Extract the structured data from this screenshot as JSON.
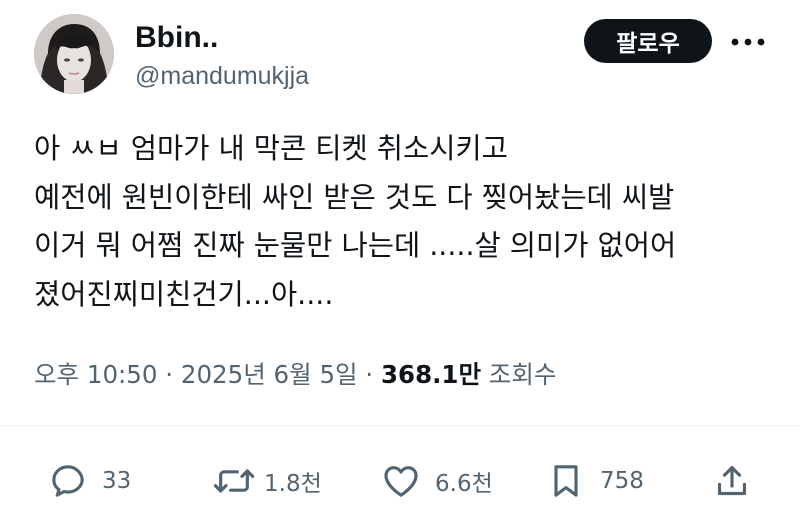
{
  "user": {
    "name": "Bbin..",
    "handle": "@mandumukjja"
  },
  "header": {
    "follow_label": "팔로우",
    "more_icon": "more-dots-icon"
  },
  "post": {
    "lines": [
      "아 ㅆㅂ 엄마가 내 막콘 티켓 취소시키고",
      "예전에 원빈이한테 싸인 받은 것도 다 찢어놨는데 씨발",
      "이거 뭐 어쩜 진짜 눈물만 나는데 .....살 의미가 없어어",
      "졌어진찌미친건기...아...."
    ]
  },
  "meta": {
    "time": "오후 10:50",
    "sep1": " · ",
    "date": "2025년 6월 5일",
    "sep2": " · ",
    "views": "368.1만",
    "views_label": " 조회수"
  },
  "actions": {
    "replies": "33",
    "reposts": "1.8천",
    "likes": "6.6천",
    "bookmarks": "758"
  },
  "colors": {
    "text": "#0f1419",
    "secondary": "#536471",
    "follow_bg": "#0f1419"
  }
}
